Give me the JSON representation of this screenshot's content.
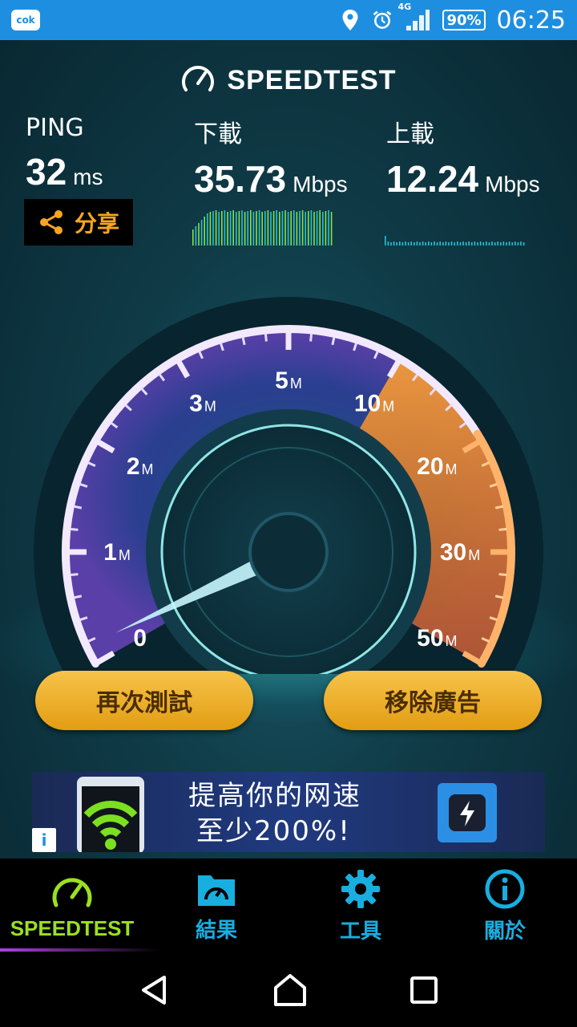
{
  "status_bar": {
    "app_badge": "cok",
    "network": "4G",
    "battery": "90%",
    "time": "06:25"
  },
  "header": {
    "logo_text": "SPEEDTEST"
  },
  "metrics": {
    "ping": {
      "label": "PING",
      "value": "32",
      "unit": "ms"
    },
    "download": {
      "label": "下載",
      "value": "35.73",
      "unit": "Mbps"
    },
    "upload": {
      "label": "上載",
      "value": "12.24",
      "unit": "Mbps"
    }
  },
  "share_button": {
    "label": "分享"
  },
  "gauge": {
    "ticks": [
      {
        "num": "0",
        "unit": ""
      },
      {
        "num": "1",
        "unit": "M"
      },
      {
        "num": "2",
        "unit": "M"
      },
      {
        "num": "3",
        "unit": "M"
      },
      {
        "num": "5",
        "unit": "M"
      },
      {
        "num": "10",
        "unit": "M"
      },
      {
        "num": "20",
        "unit": "M"
      },
      {
        "num": "30",
        "unit": "M"
      },
      {
        "num": "50",
        "unit": "M"
      }
    ],
    "needle_value": "0"
  },
  "buttons": {
    "retest": "再次測試",
    "remove_ads": "移除廣告"
  },
  "ad": {
    "line1": "提高你的网速",
    "line2": "至少200%!",
    "info": "i"
  },
  "tabs": [
    {
      "label": "SPEEDTEST",
      "icon": "gauge-icon",
      "active": true
    },
    {
      "label": "結果",
      "icon": "results-folder-icon",
      "active": false
    },
    {
      "label": "工具",
      "icon": "gear-icon",
      "active": false
    },
    {
      "label": "關於",
      "icon": "info-icon",
      "active": false
    }
  ],
  "colors": {
    "status_bar": "#1e8fe0",
    "accent_orange": "#f6a623",
    "active_tab": "#9be021",
    "tab_blue": "#19aee0"
  }
}
